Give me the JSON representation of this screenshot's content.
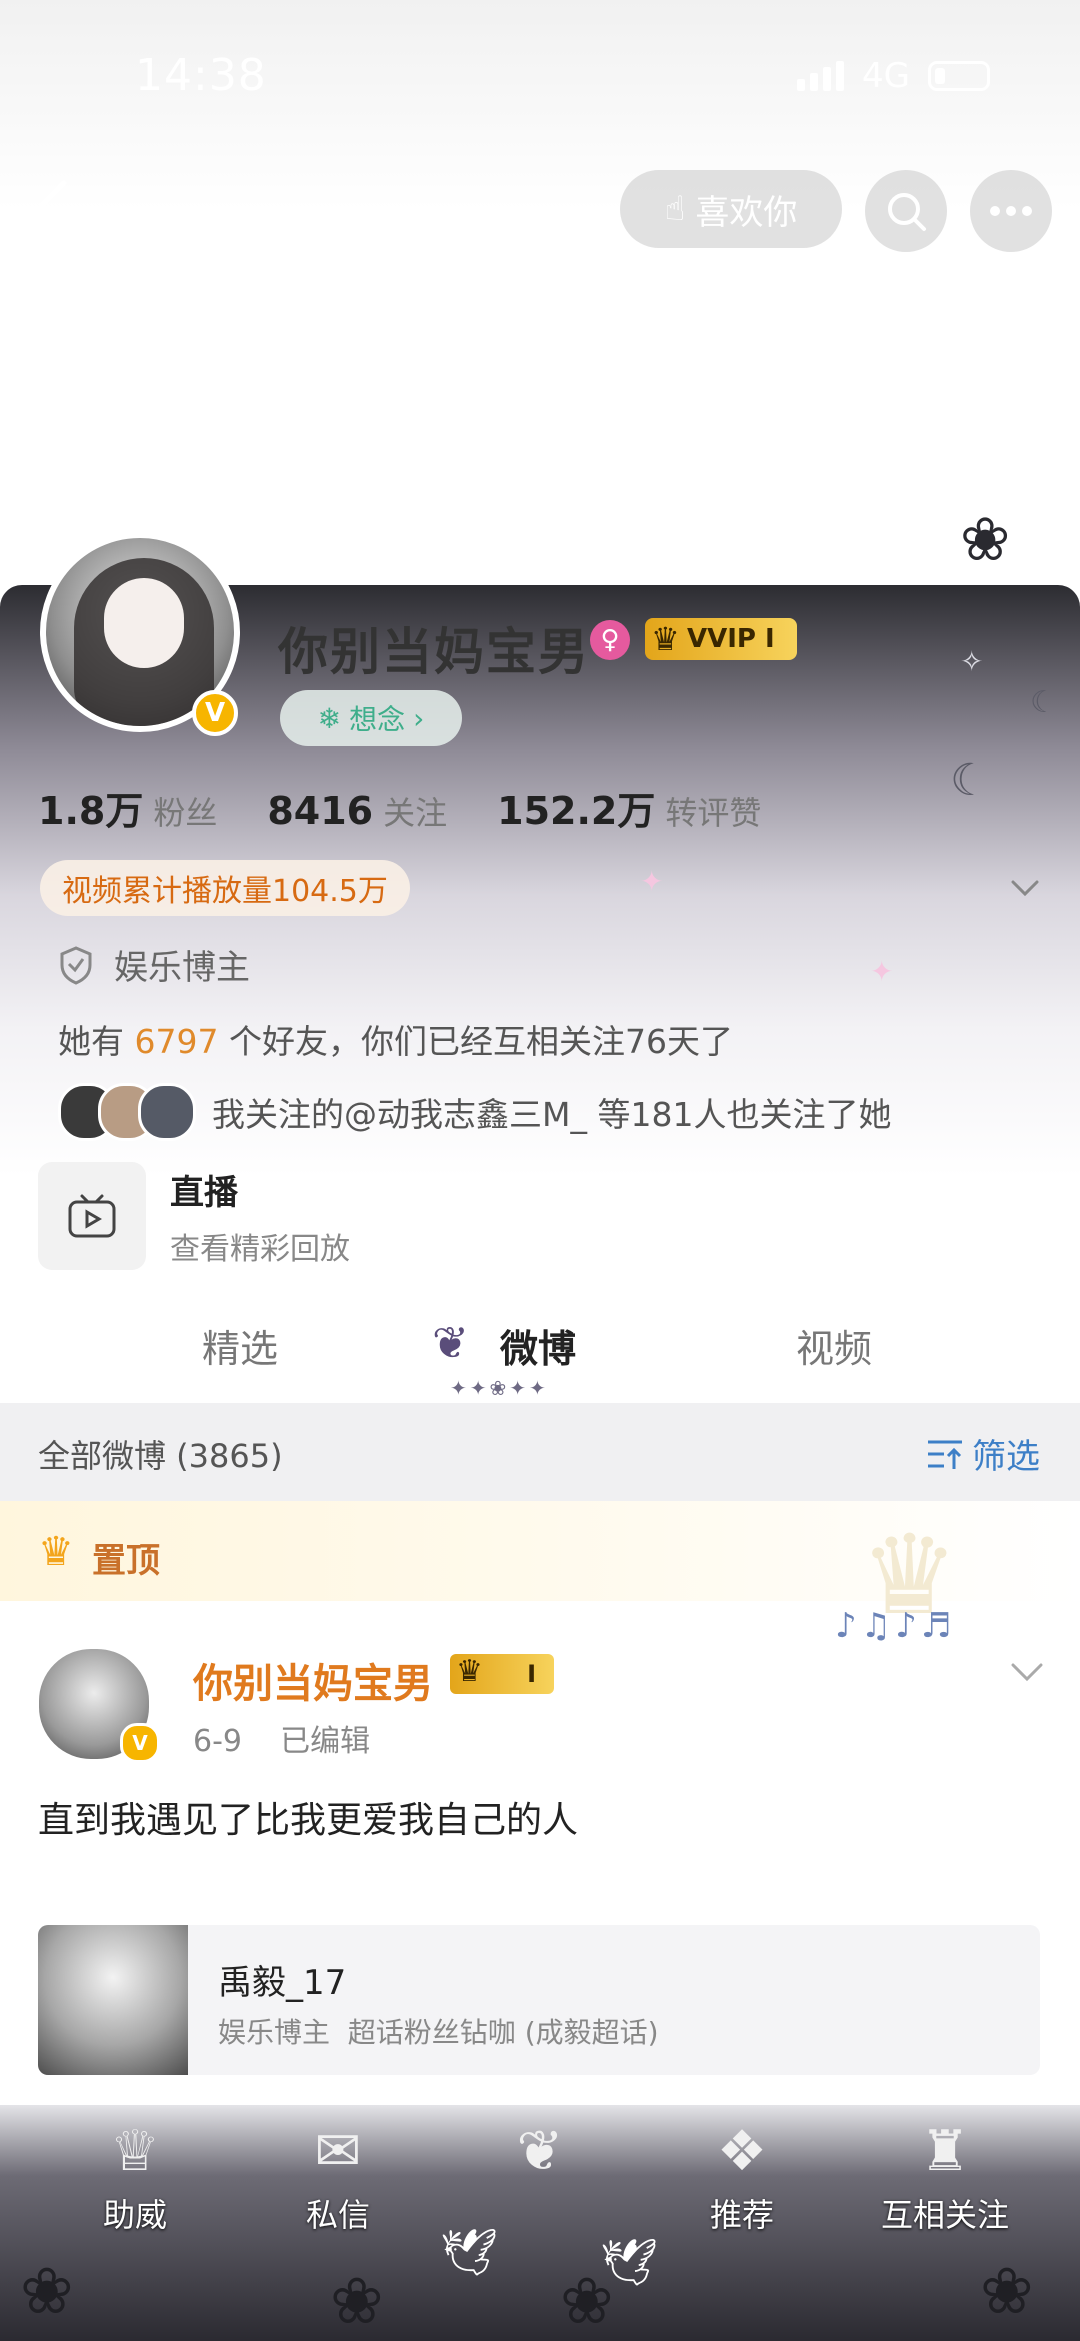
{
  "status_bar": {
    "time": "14:38",
    "network": "4G"
  },
  "top_bar": {
    "like_label": "喜欢你"
  },
  "profile": {
    "username": "你别当妈宝男",
    "vip_label": "VVIP",
    "vip_level": "I",
    "miss_label": "想念",
    "stats": [
      {
        "value": "1.8万",
        "label": "粉丝"
      },
      {
        "value": "8416",
        "label": "关注"
      },
      {
        "value": "152.2万",
        "label": "转评赞"
      }
    ],
    "play_count": "视频累计播放量104.5万",
    "tag": "娱乐博主",
    "friends_prefix": "她有",
    "friends_count": "6797",
    "friends_suffix": "个好友，你们已经互相关注76天了",
    "mutual_text": "我关注的@动我志鑫三M_ 等181人也关注了她",
    "live_title": "直播",
    "live_sub": "查看精彩回放"
  },
  "tabs": [
    "精选",
    "微博",
    "视频"
  ],
  "filter_bar": {
    "all_label": "全部微博 (3865)",
    "filter_label": "筛选"
  },
  "post": {
    "pinned_label": "置顶",
    "author": "你别当妈宝男",
    "vip_level": "I",
    "meta": "6-9    已编辑",
    "text": "直到我遇见了比我更爱我自己的人",
    "card_name": "禹毅_17",
    "card_desc": "娱乐博主  超话粉丝钻咖 (成毅超话)"
  },
  "bottom_nav": [
    "助威",
    "私信",
    "",
    "推荐",
    "互相关注"
  ],
  "colors": {
    "accent_orange": "#e07a1e",
    "link_blue": "#3d7fc7",
    "vip_gold": "#e3a51a"
  }
}
